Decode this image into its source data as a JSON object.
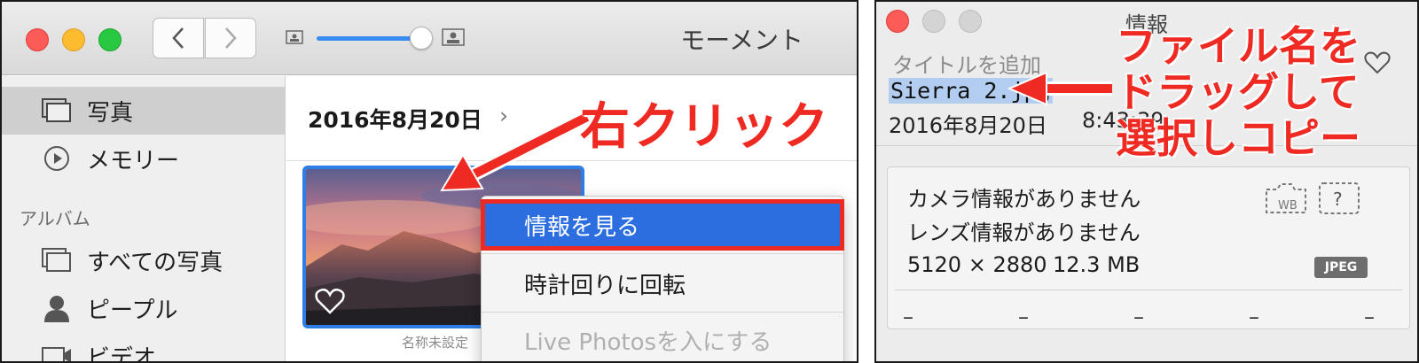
{
  "photos_window": {
    "title": "モーメント",
    "sidebar": {
      "items": [
        {
          "label": "写真",
          "icon": "photos-icon"
        },
        {
          "label": "メモリー",
          "icon": "memories-icon"
        }
      ],
      "section_header": "アルバム",
      "album_items": [
        {
          "label": "すべての写真",
          "icon": "all-photos-icon"
        },
        {
          "label": "ピープル",
          "icon": "people-icon"
        },
        {
          "label": "ビデオ",
          "icon": "video-icon"
        }
      ]
    },
    "main": {
      "date_header": "2016年8月20日",
      "chevron": "›",
      "thumb_label": "名称未設定"
    },
    "context_menu": {
      "items": [
        "情報を見る",
        "時計回りに回転",
        "Live Photosを入にする"
      ]
    },
    "annotation": "右クリック"
  },
  "info_window": {
    "title": "情報",
    "add_title_placeholder": "タイトルを追加",
    "filename": "Sierra 2.jpg",
    "date": "2016年8月20日",
    "time": "8:43:39",
    "camera_info": "カメラ情報がありません",
    "lens_info": "レンズ情報がありません",
    "dimensions": "5120 × 2880",
    "file_size": "12.3 MB",
    "format_badge": "JPEG",
    "dashes": [
      "–",
      "–",
      "–",
      "–",
      "–"
    ],
    "annotation_lines": [
      "ファイル名を",
      "ドラッグして",
      "選択しコピー"
    ]
  },
  "colors": {
    "accent_blue": "#2c6ee0",
    "annotation_red": "#ee2a22",
    "selection_blue": "#b3cdf0"
  }
}
